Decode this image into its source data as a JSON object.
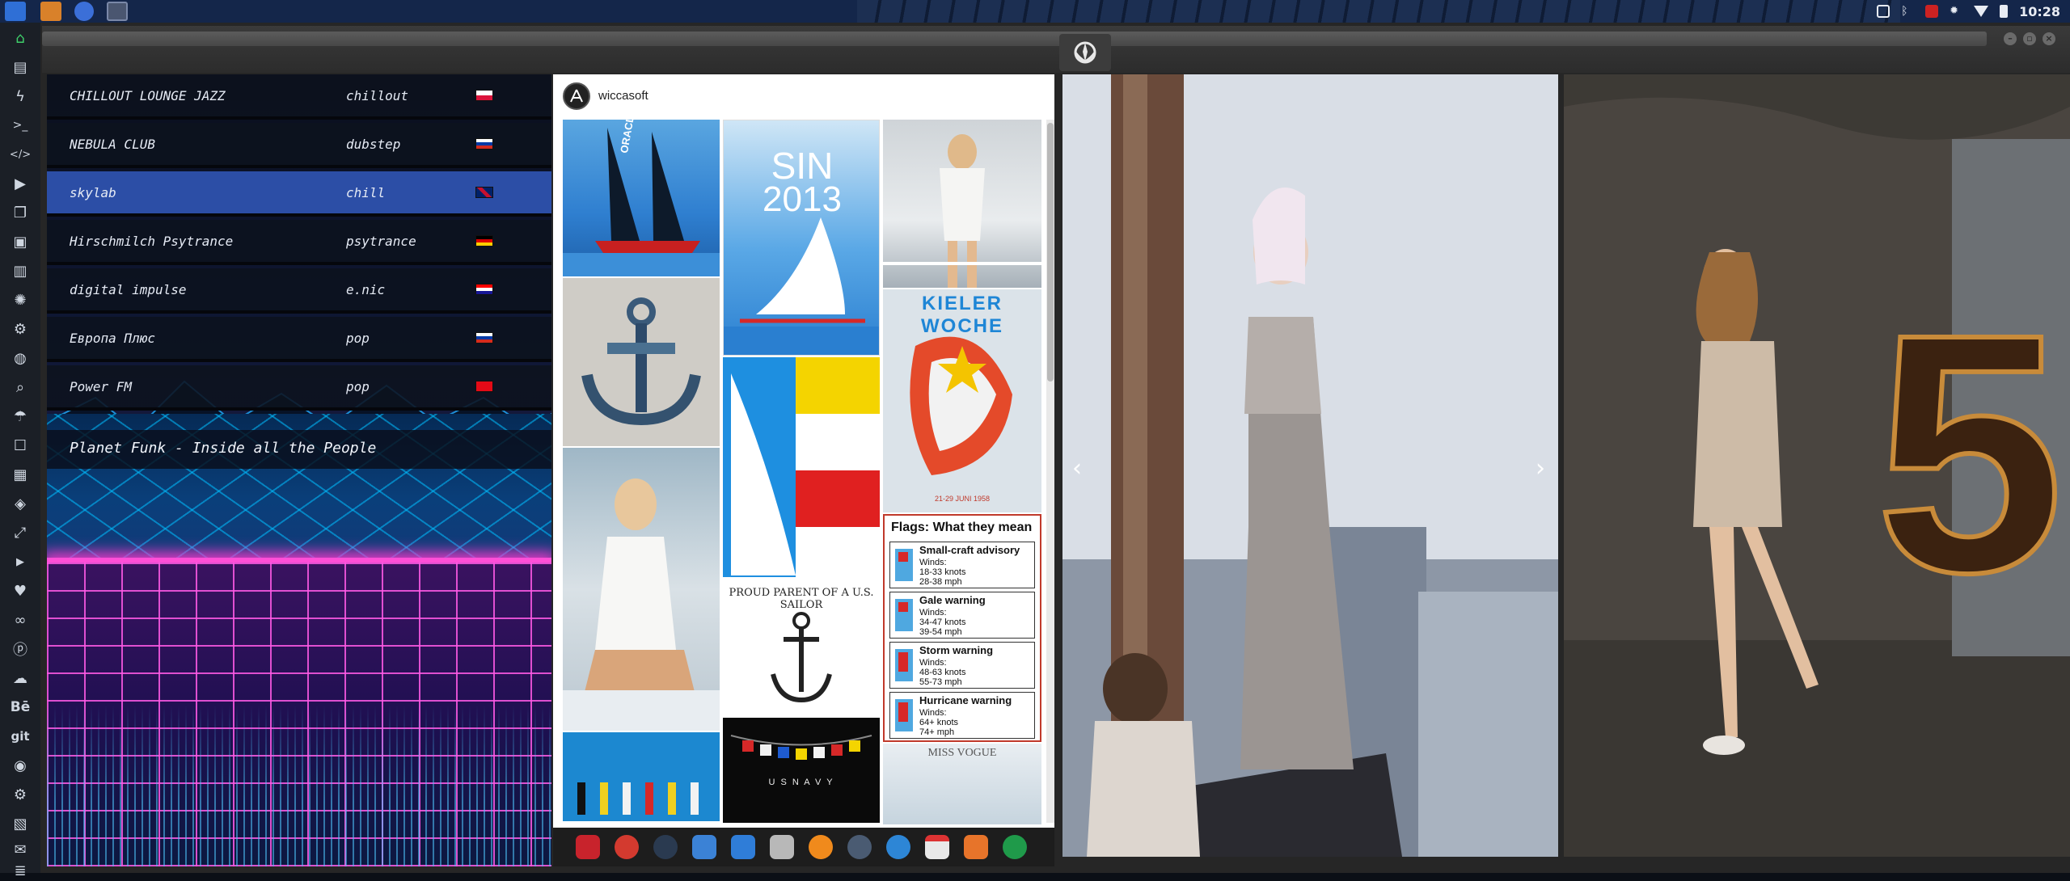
{
  "clock": "10:28",
  "radio": {
    "stations": [
      {
        "name": "CHILLOUT LOUNGE JAZZ",
        "genre": "chillout",
        "flag": "pl"
      },
      {
        "name": "NEBULA CLUB",
        "genre": "dubstep",
        "flag": "ru"
      },
      {
        "name": "skylab",
        "genre": "chill",
        "flag": "gb"
      },
      {
        "name": "Hirschmilch Psytrance",
        "genre": "psytrance",
        "flag": "de"
      },
      {
        "name": "digital impulse",
        "genre": "e.nic",
        "flag": "hr"
      },
      {
        "name": "Европа Плюс",
        "genre": "pop",
        "flag": "ru"
      },
      {
        "name": "Power FM",
        "genre": "pop",
        "flag": "tr"
      }
    ],
    "active_index": 2,
    "now_playing": "Planet Funk - Inside all the People"
  },
  "board": {
    "username": "wiccasoft",
    "pins": {
      "sin_poster": {
        "line1": "SIN",
        "line2": "2013"
      },
      "kieler_header": "KIELER WOCHE",
      "kieler_small": "21-29 JUNI 1958",
      "sailor_text": "PROUD PARENT OF A U.S. SAILOR",
      "navy_text": "U  S    N  A  V  Y",
      "oracle_text": "ORACLE",
      "vogue_text": "MISS VOGUE",
      "flags_chart": {
        "title": "Flags: What they mean",
        "rows": [
          {
            "name": "Small-craft advisory",
            "l1": "Winds:",
            "l2": "18-33 knots",
            "l3": "28-38 mph"
          },
          {
            "name": "Gale warning",
            "l1": "Winds:",
            "l2": "34-47 knots",
            "l3": "39-54 mph"
          },
          {
            "name": "Storm warning",
            "l1": "Winds:",
            "l2": "48-63 knots",
            "l3": "55-73 mph"
          },
          {
            "name": "Hurricane warning",
            "l1": "Winds:",
            "l2": "64+ knots",
            "l3": "74+ mph"
          }
        ]
      }
    }
  },
  "photos": {
    "prev_arrow": "‹",
    "next_arrow": "›",
    "big_number": "5"
  },
  "sidebar_text": {
    "behance": "Bē",
    "git": "git"
  },
  "colors": {
    "active_station": "#2c4ea6",
    "neon_pink": "#ff4fd8",
    "neon_blue": "#00beff"
  }
}
